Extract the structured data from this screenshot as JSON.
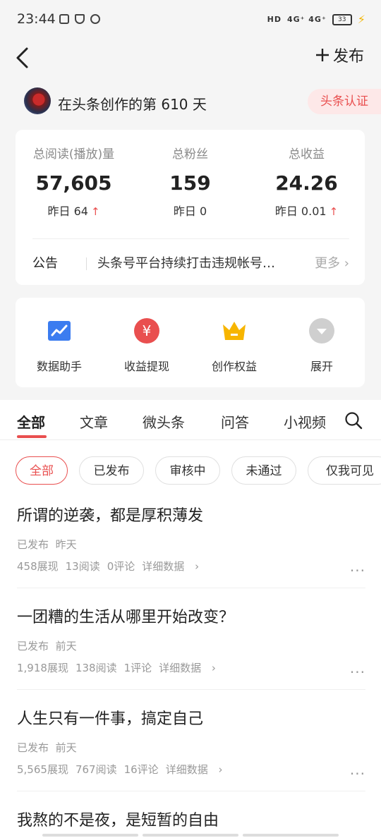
{
  "status_bar": {
    "time": "23:44",
    "network": "4G⁺ 4G⁺",
    "battery": "33"
  },
  "topbar": {
    "publish_label": "发布"
  },
  "profile": {
    "text": "在头条创作的第 610 天",
    "verify_label": "头条认证"
  },
  "stats": [
    {
      "label": "总阅读(播放)量",
      "value": "57,605",
      "sub": "昨日 64",
      "up": true
    },
    {
      "label": "总粉丝",
      "value": "159",
      "sub": "昨日 0",
      "up": false
    },
    {
      "label": "总收益",
      "value": "24.26",
      "sub": "昨日 0.01",
      "up": true
    }
  ],
  "notice": {
    "label": "公告",
    "text": "头条号平台持续打击违规帐号…",
    "more": "更多"
  },
  "tools": [
    {
      "label": "数据助手",
      "icon": "chart-icon"
    },
    {
      "label": "收益提现",
      "icon": "yuan-icon"
    },
    {
      "label": "创作权益",
      "icon": "crown-icon"
    },
    {
      "label": "展开",
      "icon": "chevron-down-icon"
    }
  ],
  "tabs": [
    "全部",
    "文章",
    "微头条",
    "问答",
    "小视频"
  ],
  "filters": [
    "全部",
    "已发布",
    "审核中",
    "未通过",
    "仅我可见"
  ],
  "articles": [
    {
      "title": "所谓的逆袭，都是厚积薄发",
      "status": "已发布",
      "time": "昨天",
      "views": "458展现",
      "reads": "13阅读",
      "comments": "0评论",
      "detail": "详细数据"
    },
    {
      "title": "一团糟的生活从哪里开始改变？",
      "status": "已发布",
      "time": "前天",
      "views": "1,918展现",
      "reads": "138阅读",
      "comments": "1评论",
      "detail": "详细数据"
    },
    {
      "title": "人生只有一件事，搞定自己",
      "status": "已发布",
      "time": "前天",
      "views": "5,565展现",
      "reads": "767阅读",
      "comments": "16评论",
      "detail": "详细数据"
    },
    {
      "title": "我熬的不是夜，是短暂的自由"
    }
  ],
  "colors": {
    "accent": "#e94f4f",
    "chart_icon": "#3b7cf0",
    "yuan_icon": "#e94f4f",
    "crown_icon": "#f7b500",
    "expand_icon": "#cfcfcf"
  }
}
